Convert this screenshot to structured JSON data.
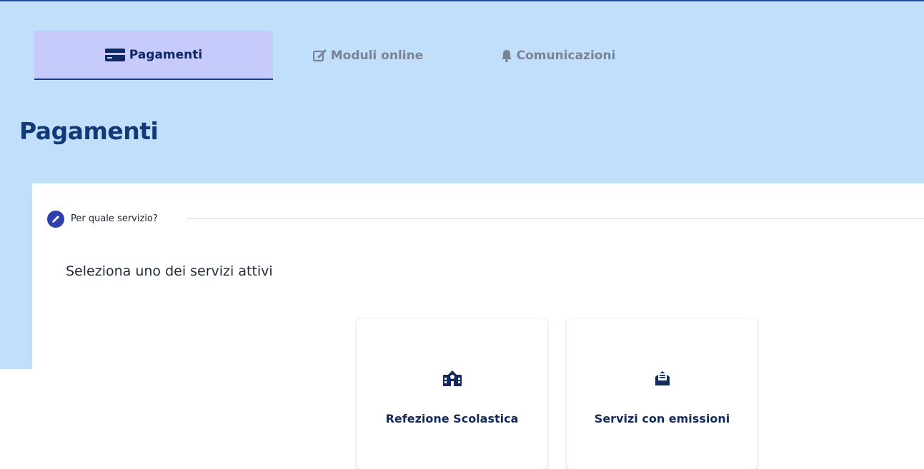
{
  "tabs": [
    {
      "label": "Pagamenti",
      "icon": "credit-card-icon",
      "active": true
    },
    {
      "label": "Moduli online",
      "icon": "edit-icon",
      "active": false
    },
    {
      "label": "Comunicazioni",
      "icon": "bell-icon",
      "active": false
    }
  ],
  "page": {
    "title": "Pagamenti"
  },
  "step": {
    "label": "Per quale servizio?",
    "icon": "pencil-icon"
  },
  "intro": {
    "text": "Seleziona uno dei servizi attivi"
  },
  "services": [
    {
      "label": "Refezione Scolastica",
      "icon": "school-icon"
    },
    {
      "label": "Servizi con emissioni",
      "icon": "envelope-open-icon"
    }
  ],
  "colors": {
    "band": "#c1dffb",
    "active_tab": "#c6cbfb",
    "title": "#123a78",
    "accent": "#2f3fae"
  }
}
